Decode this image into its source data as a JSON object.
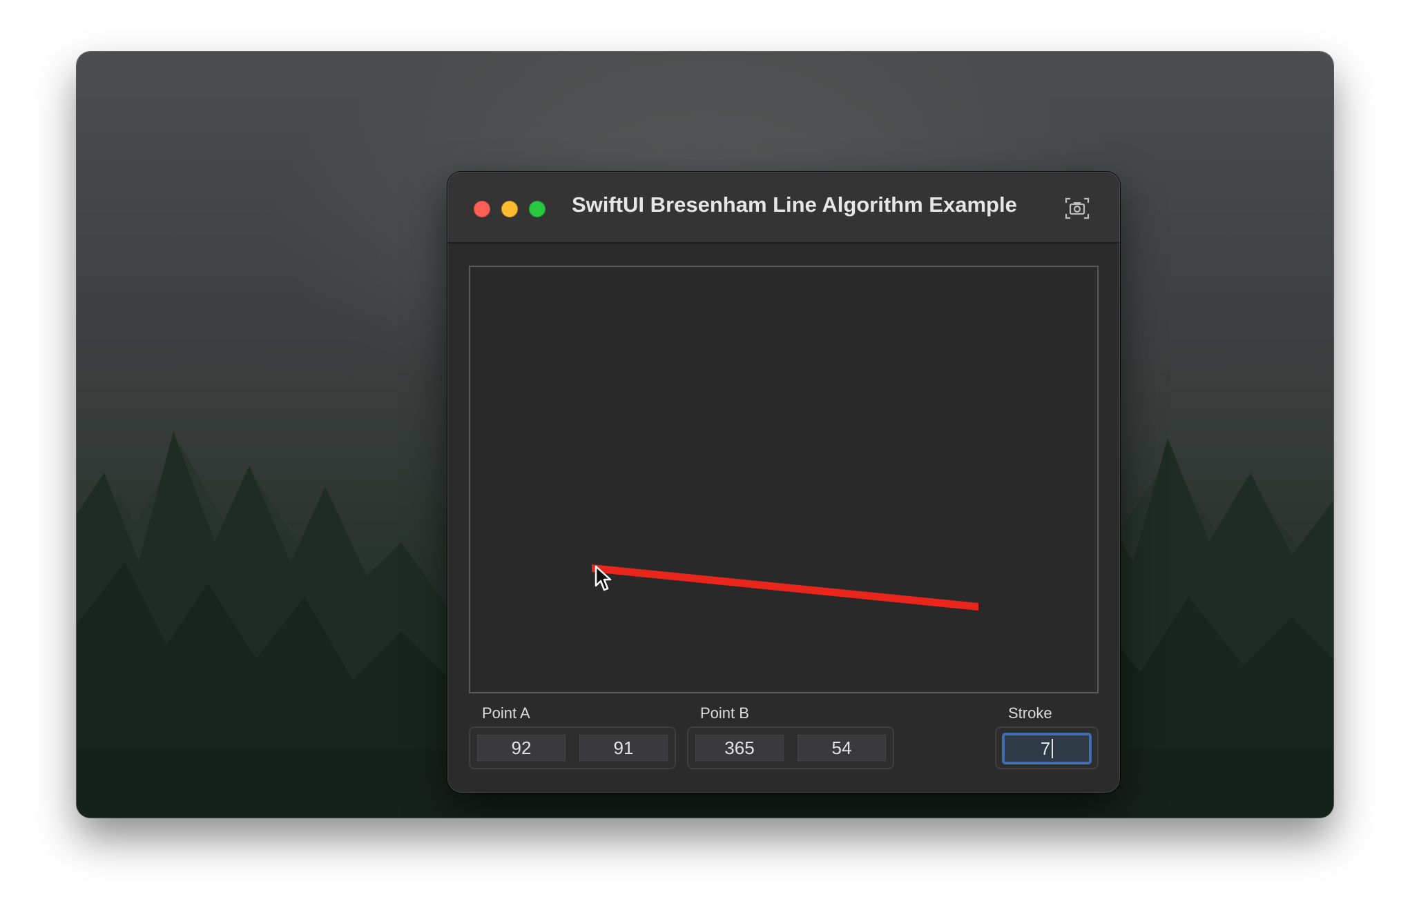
{
  "window": {
    "title": "SwiftUI Bresenham Line Algorithm Example"
  },
  "colors": {
    "line": "#e8261c",
    "canvas_bg": "#29292a",
    "focus_ring": "#3f6fb0"
  },
  "controls": {
    "point_a": {
      "label": "Point A",
      "x": "92",
      "y": "91"
    },
    "point_b": {
      "label": "Point B",
      "x": "365",
      "y": "54"
    },
    "stroke": {
      "label": "Stroke",
      "value": "7"
    }
  }
}
